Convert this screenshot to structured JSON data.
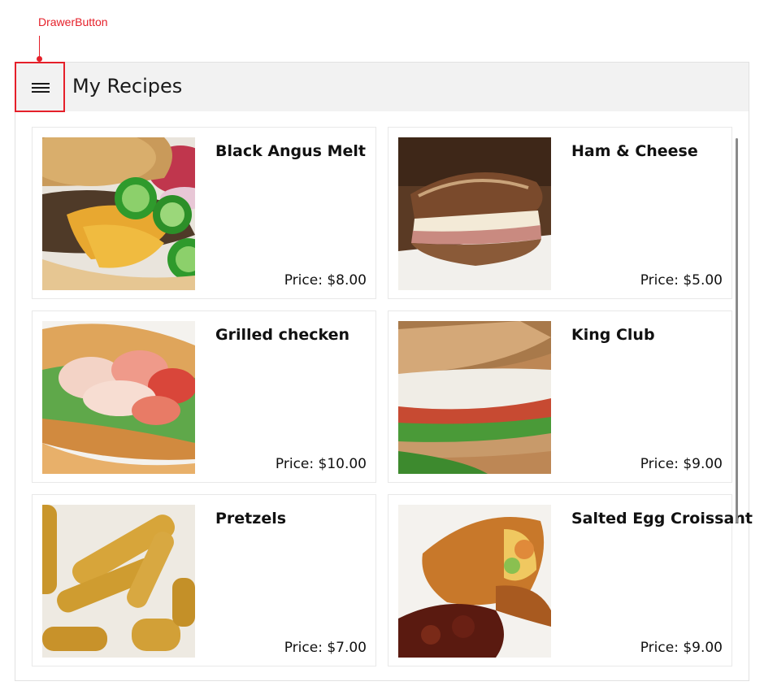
{
  "annotation": {
    "label": "DrawerButton"
  },
  "header": {
    "title": "My Recipes",
    "drawer_icon": "hamburger-menu-icon"
  },
  "recipes": [
    {
      "name": "Black Angus Melt",
      "price": "Price: $8.00"
    },
    {
      "name": "Ham & Cheese",
      "price": "Price: $5.00"
    },
    {
      "name": "Grilled checken",
      "price": "Price: $10.00"
    },
    {
      "name": "King Club",
      "price": "Price: $9.00"
    },
    {
      "name": "Pretzels",
      "price": "Price: $7.00"
    },
    {
      "name": "Salted Egg Croissant",
      "price": "Price: $9.00"
    }
  ],
  "colors": {
    "annotation": "#e5202a",
    "title_bar": "#f2f2f2",
    "text": "#111111"
  }
}
